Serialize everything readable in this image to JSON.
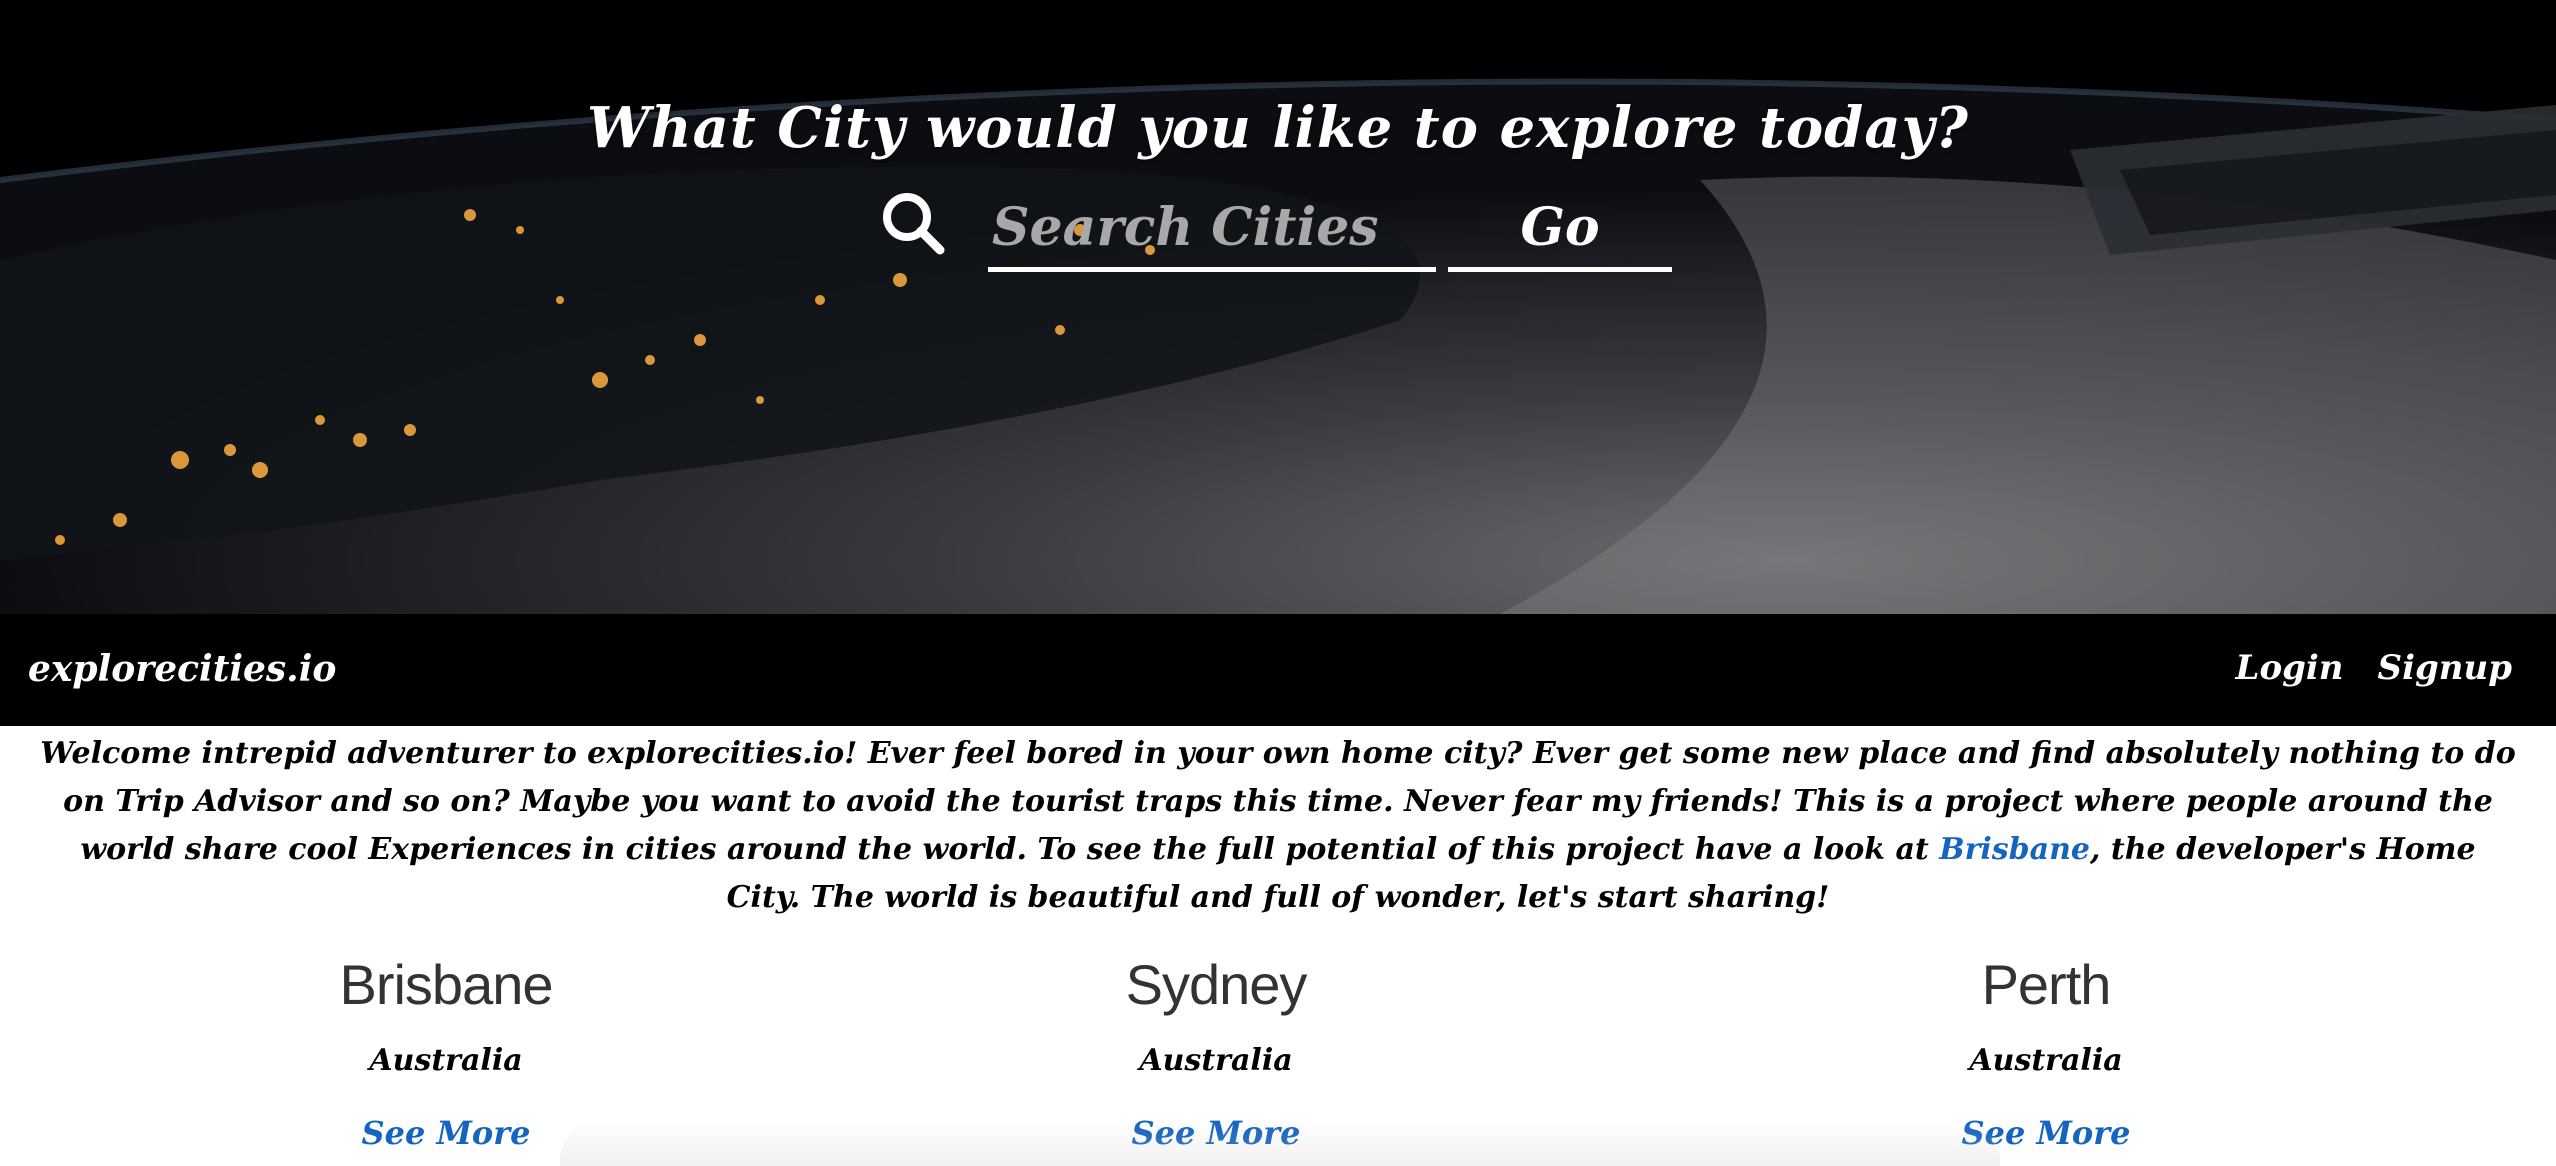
{
  "hero": {
    "title": "What City would you like to explore today?",
    "search_placeholder": "Search Cities",
    "search_value": "",
    "go_label": "Go"
  },
  "navbar": {
    "brand": "explorecities.io",
    "links": [
      {
        "label": "Login"
      },
      {
        "label": "Signup"
      }
    ]
  },
  "intro": {
    "text_before": "Welcome intrepid adventurer to explorecities.io! Ever feel bored in your own home city? Ever get some new place and find absolutely nothing to do on Trip Advisor and so on? Maybe you want to avoid the tourist traps this time. Never fear my friends! This is a project where people around the world share cool Experiences in cities around the world. To see the full potential of this project have a look at ",
    "link_text": "Brisbane",
    "text_after": ", the developer's Home City. The world is beautiful and full of wonder, let's start sharing!"
  },
  "cities": [
    {
      "name": "Brisbane",
      "country": "Australia",
      "link": "See More"
    },
    {
      "name": "Sydney",
      "country": "Australia",
      "link": "See More"
    },
    {
      "name": "Perth",
      "country": "Australia",
      "link": "See More"
    }
  ],
  "colors": {
    "link": "#1565c0",
    "navbar": "#000000",
    "hero_bg": "#05070b"
  }
}
